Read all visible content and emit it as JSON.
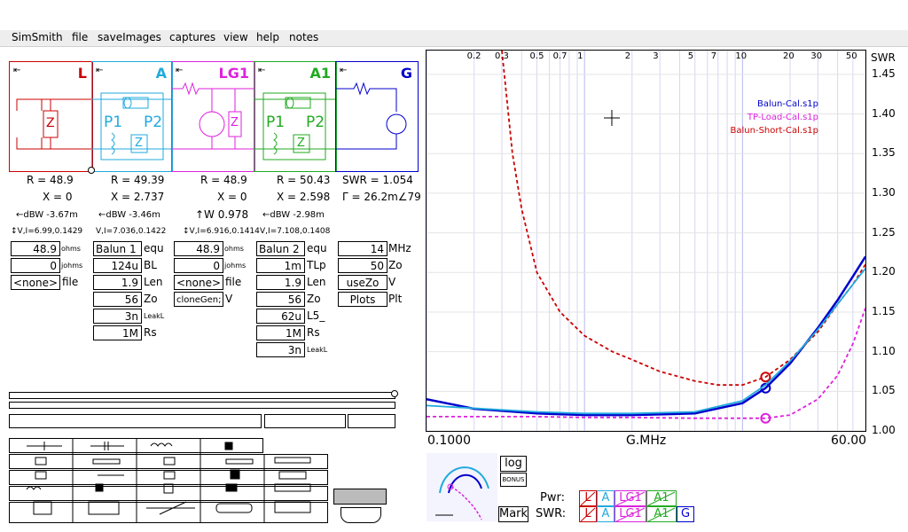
{
  "menu": [
    "SimSmith",
    "file",
    "saveImages",
    "captures",
    "view",
    "help",
    "notes"
  ],
  "blocks": [
    {
      "name": "L",
      "color": "#cc0000"
    },
    {
      "name": "A",
      "color": "#22aadd"
    },
    {
      "name": "LG1",
      "color": "#dd22dd"
    },
    {
      "name": "A1",
      "color": "#22aa22"
    },
    {
      "name": "G",
      "color": "#0000cc"
    }
  ],
  "block_icons": {
    "arrow": "⇤",
    "z": "Z",
    "p1": "P1",
    "p2": "P2"
  },
  "readouts": {
    "L": {
      "r": "R = 48.9",
      "x": "X = 0",
      "dbw": "←dBW -3.67m",
      "vi": "↕V,I=6.99,0.1429"
    },
    "A": {
      "r": "R = 49.39",
      "x": "X = 2.737",
      "dbw": "←dBW -3.46m",
      "vi": "V,I=7.036,0.1422"
    },
    "LG1": {
      "r": "R = 48.9",
      "x": "X = 0",
      "w": "↑W 0.978",
      "vi": "↕V,I=6.916,0.1414"
    },
    "A1": {
      "r": "R = 50.43",
      "x": "X = 2.598",
      "dbw": "←dBW -2.98m",
      "vi": "V,I=7.108,0.1408"
    },
    "G": {
      "swr": "SWR = 1.054",
      "gamma": "Γ = 26.2m∠79"
    }
  },
  "params": {
    "L": [
      {
        "value": "48.9",
        "label": "ohms"
      },
      {
        "value": "0",
        "label": "johms"
      },
      {
        "value": "<none>",
        "label": "file"
      }
    ],
    "A": [
      {
        "value": "Balun 1",
        "label": "equ"
      },
      {
        "value": "124u",
        "label": "BL"
      },
      {
        "value": "1.9",
        "label": "Len"
      },
      {
        "value": "56",
        "label": "Zo"
      },
      {
        "value": "3n",
        "label": "LeakL"
      },
      {
        "value": "1M",
        "label": "Rs"
      }
    ],
    "LG1": [
      {
        "value": "48.9",
        "label": "ohms"
      },
      {
        "value": "0",
        "label": "johms"
      },
      {
        "value": "<none>",
        "label": "file"
      },
      {
        "value": "cloneGen;",
        "label": "V"
      }
    ],
    "A1": [
      {
        "value": "Balun 2",
        "label": "equ"
      },
      {
        "value": "1m",
        "label": "TLp"
      },
      {
        "value": "1.9",
        "label": "Len"
      },
      {
        "value": "56",
        "label": "Zo"
      },
      {
        "value": "62u",
        "label": "L5_"
      },
      {
        "value": "1M",
        "label": "Rs"
      },
      {
        "value": "3n",
        "label": "LeakL"
      }
    ],
    "G": [
      {
        "value": "14",
        "label": "MHz"
      },
      {
        "value": "50",
        "label": "Zo"
      },
      {
        "value": "useZo",
        "label": "V"
      },
      {
        "value": "Plots",
        "label": "Plt"
      }
    ]
  },
  "chart_data": {
    "type": "line",
    "x_scale": "log",
    "x_range": [
      0.1,
      60
    ],
    "xlabel": "G.MHz",
    "x_left_label": "0.1000",
    "x_right_label": "60.00",
    "ylabel": "SWR",
    "ylim": [
      1.0,
      1.48
    ],
    "top_ticks": [
      "0.2",
      "0.3",
      "0.5",
      "0.7",
      "1",
      "2",
      "3",
      "5",
      "7",
      "10",
      "20",
      "30",
      "50"
    ],
    "top_tick_values": [
      0.2,
      0.3,
      0.5,
      0.7,
      1,
      2,
      3,
      5,
      7,
      10,
      20,
      30,
      50
    ],
    "y_ticks": [
      "1.45",
      "1.40",
      "1.35",
      "1.30",
      "1.25",
      "1.20",
      "1.15",
      "1.10",
      "1.05",
      "1.00"
    ],
    "y_tick_values": [
      1.45,
      1.4,
      1.35,
      1.3,
      1.25,
      1.2,
      1.15,
      1.1,
      1.05,
      1.0
    ],
    "marker_x": 14,
    "series": [
      {
        "name": "Balun-Cal.s1p",
        "color": "#0000cc",
        "x": [
          0.1,
          0.2,
          0.5,
          1,
          2,
          5,
          10,
          14,
          20,
          30,
          40,
          50,
          60
        ],
        "y": [
          1.04,
          1.028,
          1.022,
          1.02,
          1.02,
          1.022,
          1.035,
          1.054,
          1.085,
          1.13,
          1.165,
          1.195,
          1.22
        ]
      },
      {
        "name": "TP-Load-Cal.s1p",
        "color": "#dd22dd",
        "x": [
          0.1,
          0.5,
          1,
          2,
          5,
          10,
          14,
          20,
          30,
          40,
          50,
          60
        ],
        "y": [
          1.018,
          1.018,
          1.017,
          1.017,
          1.016,
          1.016,
          1.016,
          1.02,
          1.04,
          1.07,
          1.11,
          1.155
        ]
      },
      {
        "name": "Balun-Short-Cal.s1p",
        "color": "#cc0000",
        "x": [
          0.3,
          0.35,
          0.4,
          0.5,
          0.7,
          1,
          1.5,
          2,
          3,
          5,
          7,
          10,
          14,
          20,
          30,
          40,
          50,
          60
        ],
        "y": [
          1.48,
          1.35,
          1.28,
          1.2,
          1.15,
          1.12,
          1.1,
          1.09,
          1.075,
          1.063,
          1.058,
          1.058,
          1.068,
          1.09,
          1.125,
          1.16,
          1.185,
          1.21
        ]
      },
      {
        "name": "",
        "color": "#22aadd",
        "x": [
          0.1,
          0.5,
          1,
          2,
          5,
          10,
          14,
          20,
          30,
          40,
          50,
          60
        ],
        "y": [
          1.032,
          1.024,
          1.022,
          1.022,
          1.024,
          1.038,
          1.058,
          1.088,
          1.128,
          1.16,
          1.185,
          1.205
        ]
      }
    ]
  },
  "mini_ctrl": {
    "log": "log",
    "bonus": "BONUS",
    "mark": "Mark"
  },
  "pwr": {
    "pwr_label": "Pwr:",
    "swr_label": "SWR:",
    "buttons": [
      "L",
      "A",
      "LG1",
      "A1"
    ],
    "swr_buttons": [
      "L",
      "A",
      "LG1",
      "A1",
      "G"
    ]
  }
}
